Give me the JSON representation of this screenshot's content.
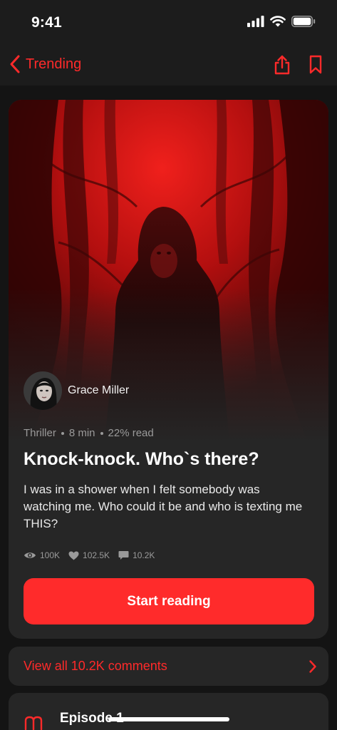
{
  "status_bar": {
    "time": "9:41"
  },
  "nav": {
    "back_label": "Trending"
  },
  "story": {
    "author_name": "Grace Miller",
    "genre": "Thriller",
    "read_time": "8 min",
    "progress": "22% read",
    "progress_fraction": 0.22,
    "title": "Knock-knock. Who`s there?",
    "description": "I was in a shower when I felt somebody was watching me. Who could it be and who is texting me THIS?",
    "views": "100K",
    "likes": "102.5K",
    "comments": "10.2K",
    "cta_label": "Start reading"
  },
  "comments_link": {
    "label": "View all 10.2K comments"
  },
  "episode": {
    "title": "Episode 1"
  },
  "colors": {
    "accent": "#ff2b2b",
    "background": "#141414",
    "card": "#262626"
  }
}
